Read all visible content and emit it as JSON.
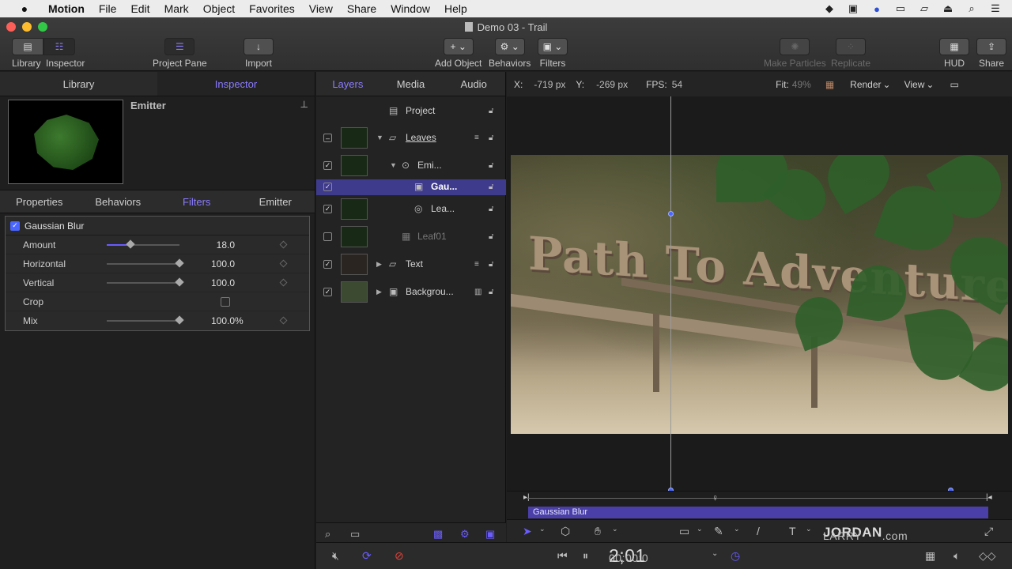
{
  "menubar": {
    "apple": "",
    "app": "Motion",
    "items": [
      "File",
      "Edit",
      "Mark",
      "Object",
      "Favorites",
      "View",
      "Share",
      "Window",
      "Help"
    ]
  },
  "window": {
    "title": "Demo 03 - Trail"
  },
  "toolbar": {
    "library": "Library",
    "inspector": "Inspector",
    "project_pane": "Project Pane",
    "import": "Import",
    "add_object": "Add Object",
    "behaviors": "Behaviors",
    "filters": "Filters",
    "make_particles": "Make Particles",
    "replicate": "Replicate",
    "hud": "HUD",
    "share": "Share"
  },
  "left_panel": {
    "tabs": [
      "Library",
      "Inspector"
    ],
    "active_tab": "Inspector",
    "preview_name": "Emitter",
    "sub_tabs": [
      "Properties",
      "Behaviors",
      "Filters",
      "Emitter"
    ],
    "active_sub_tab": "Filters",
    "filter": {
      "name": "Gaussian Blur",
      "enabled": true,
      "params": [
        {
          "label": "Amount",
          "value": "18.0",
          "unit": "",
          "level": 0.2
        },
        {
          "label": "Horizontal",
          "value": "100.0",
          "unit": "",
          "level": 1.0
        },
        {
          "label": "Vertical",
          "value": "100.0",
          "unit": "",
          "level": 1.0
        },
        {
          "label": "Crop",
          "value": "",
          "unit": "",
          "checkbox": false
        },
        {
          "label": "Mix",
          "value": "100.0",
          "unit": "%",
          "level": 1.0
        }
      ]
    }
  },
  "layers_panel": {
    "tabs": [
      "Layers",
      "Media",
      "Audio"
    ],
    "active_tab": "Layers",
    "rows": [
      {
        "name": "Project"
      },
      {
        "name": "Leaves"
      },
      {
        "name": "Emi..."
      },
      {
        "name": "Gau..."
      },
      {
        "name": "Lea..."
      },
      {
        "name": "Leaf01"
      },
      {
        "name": "Text"
      },
      {
        "name": "Backgrou..."
      }
    ]
  },
  "canvas": {
    "x_label": "X:",
    "x_value": "-719 px",
    "y_label": "Y:",
    "y_value": "-269 px",
    "fps_label": "FPS:",
    "fps_value": "54",
    "fit_label": "Fit:",
    "fit_value": "49%",
    "render": "Render",
    "view": "View",
    "overlay_text": "Path To Adventure"
  },
  "timeline": {
    "bar_label": "Gaussian Blur"
  },
  "watermark": {
    "prefix": "LARRY",
    "bold": "JORDAN",
    "suffix": ".com"
  },
  "transport": {
    "timecode_dim": "00:00:0",
    "timecode_bright": "2;01"
  },
  "colors": {
    "accent": "#8b7cff",
    "selection": "#3e3a8c",
    "timeline_bar": "#4a3fa8"
  }
}
